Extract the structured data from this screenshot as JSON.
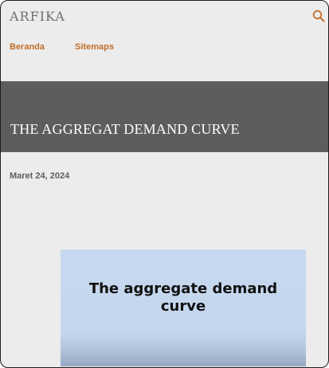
{
  "site": {
    "title": "ARFIKA"
  },
  "nav": {
    "items": [
      {
        "label": "Beranda"
      },
      {
        "label": "Sitemaps"
      }
    ]
  },
  "search": {
    "icon": "search-icon"
  },
  "post": {
    "title": "THE AGGREGAT DEMAND CURVE",
    "date": "Maret 24, 2024",
    "image_caption_line1": "The aggregate demand",
    "image_caption_line2": "curve"
  },
  "colors": {
    "accent": "#c16e2c",
    "hero_bg": "#5e5c5f",
    "page_bg": "#ececec",
    "image_bg": "#c6d8ef"
  }
}
